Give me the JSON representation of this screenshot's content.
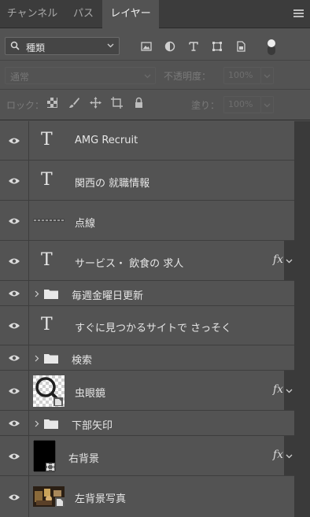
{
  "tabs": [
    {
      "label": "チャンネル",
      "active": false
    },
    {
      "label": "パス",
      "active": false
    },
    {
      "label": "レイヤー",
      "active": true
    }
  ],
  "filter": {
    "kind_label": "種類"
  },
  "blend": {
    "mode": "通常",
    "opacity_label": "不透明度：",
    "opacity_value": "100%"
  },
  "lock": {
    "label": "ロック：",
    "fill_label": "塗り：",
    "fill_value": "100%"
  },
  "layers": [
    {
      "name": "AMG Recruit",
      "type": "text",
      "fx": false
    },
    {
      "name": "関西の 就職情報",
      "type": "text",
      "fx": false
    },
    {
      "name": "点線",
      "type": "line",
      "fx": false
    },
    {
      "name": "サービス・ 飲食の 求人",
      "type": "text",
      "fx": true,
      "fx_label": "fx"
    },
    {
      "name": "毎週金曜日更新",
      "type": "group",
      "fx": false
    },
    {
      "name": "すぐに見つかるサイトで さっそく",
      "type": "text",
      "fx": false
    },
    {
      "name": "検索",
      "type": "group",
      "fx": false
    },
    {
      "name": "虫眼鏡",
      "type": "smart",
      "fx": true,
      "fx_label": "fx"
    },
    {
      "name": "下部矢印",
      "type": "group",
      "fx": false
    },
    {
      "name": "右背景",
      "type": "shape",
      "fx": true,
      "fx_label": "fx"
    },
    {
      "name": "左背景写真",
      "type": "photo",
      "fx": false
    }
  ],
  "colors": {
    "panel": "#535353",
    "tabbar": "#3c3c3c",
    "text": "#e6e6e6"
  }
}
